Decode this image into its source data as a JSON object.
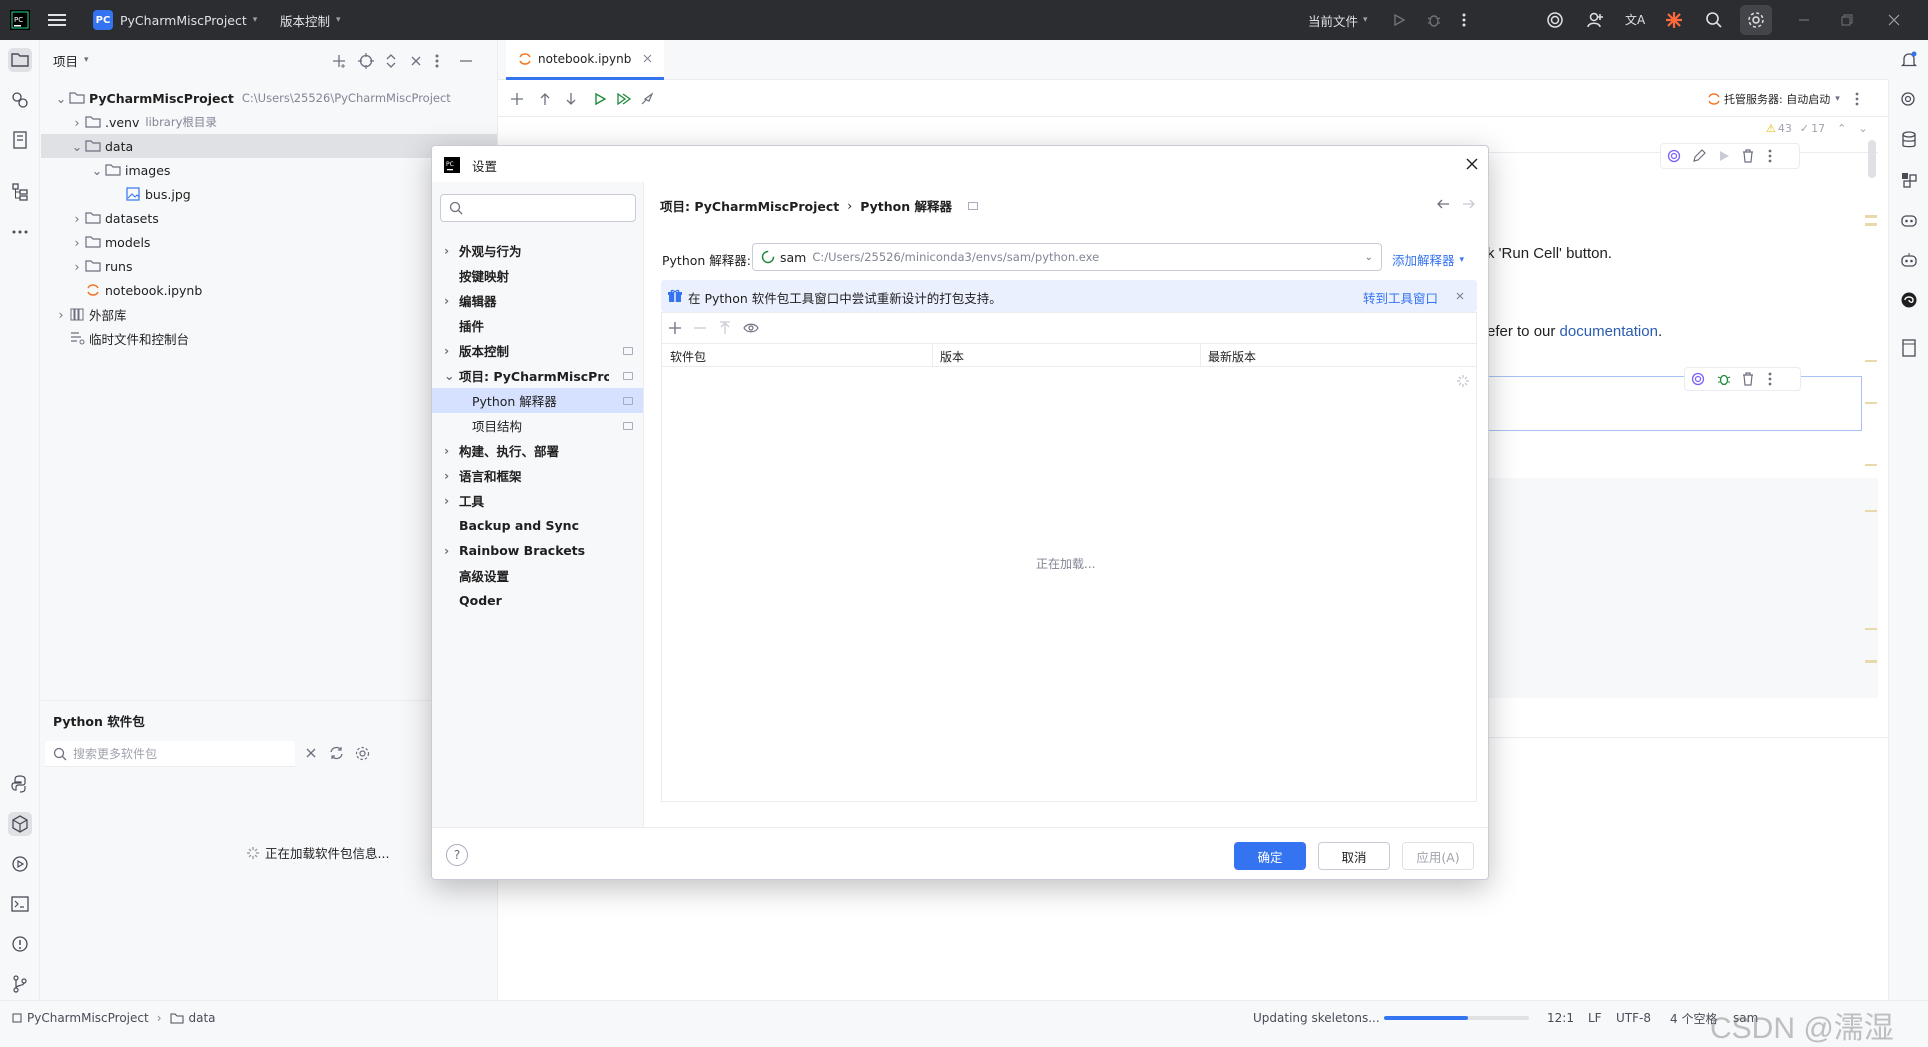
{
  "titlebar": {
    "project_badge": "PC",
    "project_name": "PyCharmMiscProject",
    "vcs_menu": "版本控制",
    "run_config": "当前文件"
  },
  "project_panel": {
    "title": "项目",
    "tree": [
      {
        "label": "PyCharmMiscProject",
        "hint": "C:\\Users\\25526\\PyCharmMiscProject"
      },
      {
        "label": ".venv",
        "hint": "library根目录"
      },
      {
        "label": "data",
        "hint": ""
      },
      {
        "label": "images",
        "hint": ""
      },
      {
        "label": "bus.jpg",
        "hint": ""
      },
      {
        "label": "datasets",
        "hint": ""
      },
      {
        "label": "models",
        "hint": ""
      },
      {
        "label": "runs",
        "hint": ""
      },
      {
        "label": "notebook.ipynb",
        "hint": ""
      },
      {
        "label": "外部库",
        "hint": ""
      },
      {
        "label": "临时文件和控制台",
        "hint": ""
      }
    ]
  },
  "packages_panel": {
    "title": "Python 软件包",
    "search_placeholder": "搜索更多软件包",
    "loading": "正在加载软件包信息..."
  },
  "editor": {
    "tab": "notebook.ipynb",
    "server": "托管服务器: 自动启动",
    "warnings": "43",
    "checks": "17",
    "text_line1": "k 'Run Cell' button.",
    "text_line2_prefix": "efer to our ",
    "text_line2_link": "documentation",
    "text_line2_suffix": "."
  },
  "dialog": {
    "title": "设置",
    "search_placeholder": "",
    "nav": [
      {
        "label": "外观与行为",
        "chev": true,
        "sub": false
      },
      {
        "label": "按键映射",
        "chev": false,
        "sub": false
      },
      {
        "label": "编辑器",
        "chev": true,
        "sub": false
      },
      {
        "label": "插件",
        "chev": false,
        "sub": false
      },
      {
        "label": "版本控制",
        "chev": true,
        "sub": false,
        "badge": true
      },
      {
        "label": "项目: PyCharmMiscProject",
        "chev": true,
        "sub": false,
        "badge": true,
        "open": true
      },
      {
        "label": "Python 解释器",
        "chev": false,
        "sub": true,
        "badge": true,
        "sel": true
      },
      {
        "label": "项目结构",
        "chev": false,
        "sub": true,
        "badge": true
      },
      {
        "label": "构建、执行、部署",
        "chev": true,
        "sub": false
      },
      {
        "label": "语言和框架",
        "chev": true,
        "sub": false
      },
      {
        "label": "工具",
        "chev": true,
        "sub": false
      },
      {
        "label": "Backup and Sync",
        "chev": false,
        "sub": false
      },
      {
        "label": "Rainbow Brackets",
        "chev": true,
        "sub": false
      },
      {
        "label": "高级设置",
        "chev": false,
        "sub": false
      },
      {
        "label": "Qoder",
        "chev": false,
        "sub": false
      }
    ],
    "breadcrumb_project": "项目: PyCharmMiscProject",
    "breadcrumb_sep": "›",
    "breadcrumb_page": "Python 解释器",
    "interpreter_label": "Python 解释器:",
    "interpreter_name": "sam",
    "interpreter_path": "C:/Users/25526/miniconda3/envs/sam/python.exe",
    "add_interpreter": "添加解释器",
    "banner_text": "在 Python 软件包工具窗口中尝试重新设计的打包支持。",
    "banner_link": "转到工具窗口",
    "columns": [
      "软件包",
      "版本",
      "最新版本"
    ],
    "loading": "正在加载...",
    "ok": "确定",
    "cancel": "取消",
    "apply": "应用(A)"
  },
  "statusbar": {
    "crumb_project": "PyCharmMiscProject",
    "crumb_folder": "data",
    "task": "Updating skeletons...",
    "progress": 0.58,
    "position": "12:1",
    "line_sep": "LF",
    "encoding": "UTF-8",
    "indent": "4 个空格",
    "interpreter": "sam",
    "watermark": "CSDN @濡湿"
  },
  "colors": {
    "accent": "#3574f0",
    "titlebar": "#2b2d30",
    "selection": "#d5e1ff"
  }
}
